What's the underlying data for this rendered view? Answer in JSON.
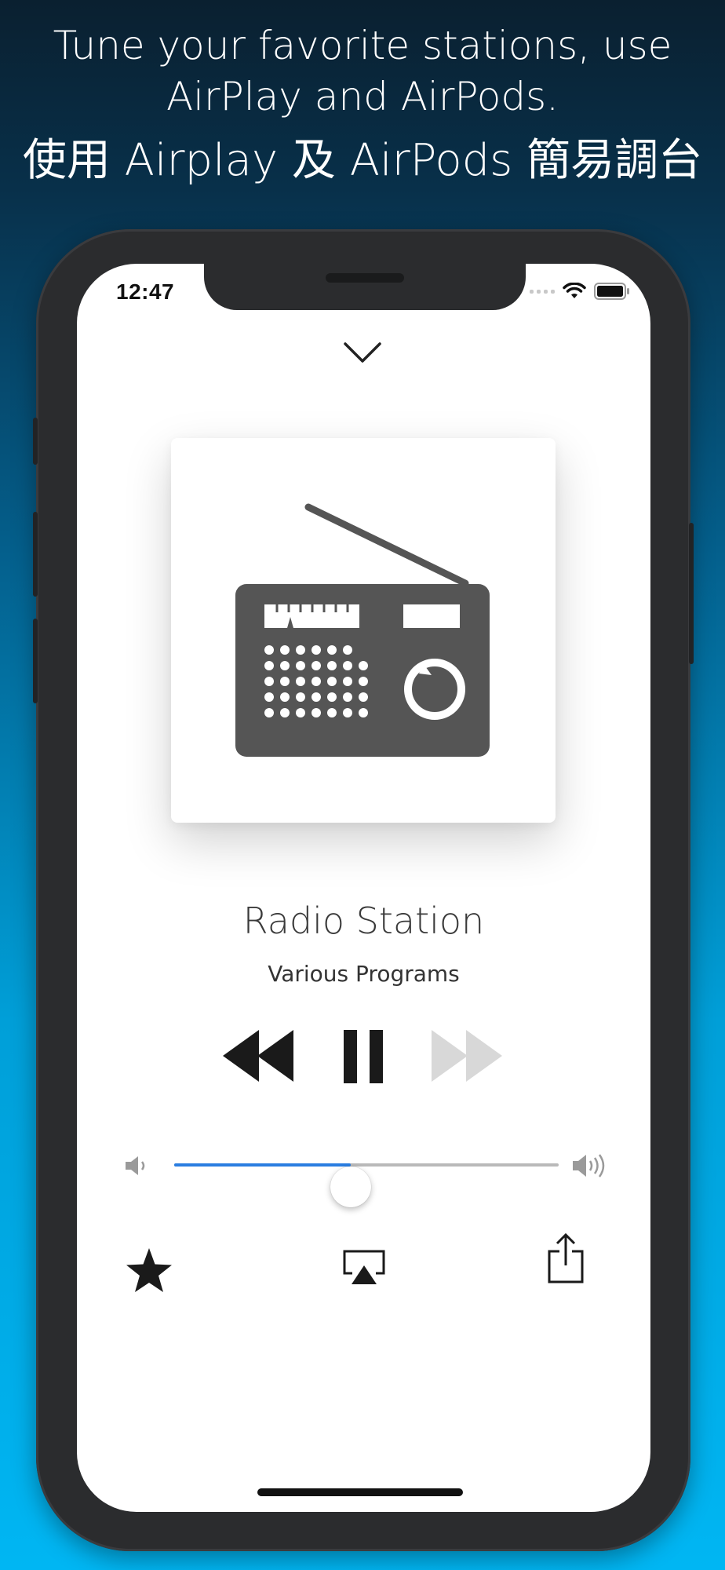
{
  "promo": {
    "line1": "Tune your favorite stations, use",
    "line2": "AirPlay and AirPods.",
    "line3": "使用 Airplay 及 AirPods 簡易調台"
  },
  "status_bar": {
    "time": "12:47",
    "icons": [
      "signal-icon",
      "wifi-icon",
      "battery-icon"
    ]
  },
  "player": {
    "station_name": "Radio Station",
    "program": "Various Programs",
    "artwork_icon": "radio-icon",
    "volume": 0.46,
    "controls": [
      "rewind-icon",
      "pause-icon",
      "fast-forward-icon"
    ],
    "actions": [
      "star-icon",
      "airplay-icon",
      "share-icon"
    ]
  },
  "colors": {
    "accent": "#2a7de1",
    "icon": "#555555",
    "disabled": "#d8d8d8"
  }
}
